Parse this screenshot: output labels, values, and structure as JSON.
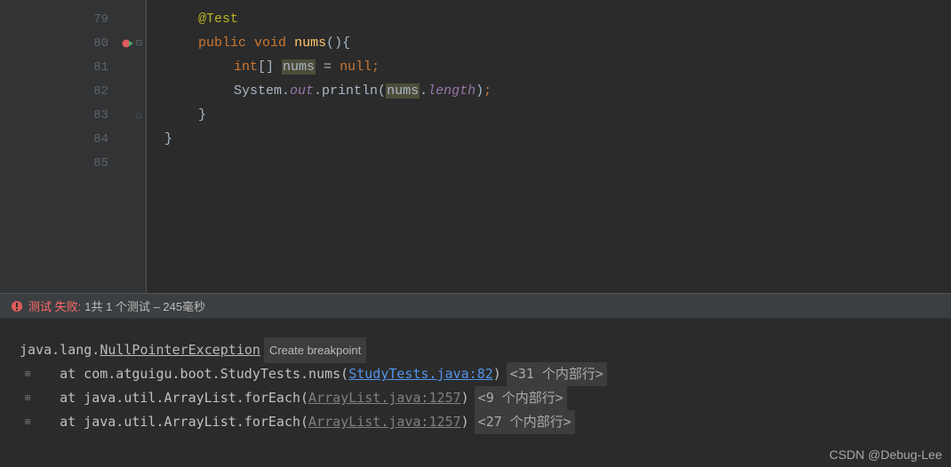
{
  "gutter": {
    "lines": [
      "79",
      "80",
      "81",
      "82",
      "83",
      "84",
      "85"
    ]
  },
  "code": {
    "l79_annotation": "@Test",
    "l80_public": "public",
    "l80_void": "void",
    "l80_method": "nums",
    "l80_paren": "(){",
    "l81_type": "int",
    "l81_brackets": "[] ",
    "l81_var": "nums",
    "l81_eq": " = ",
    "l81_null": "null",
    "l81_semi": ";",
    "l82_sys": "System.",
    "l82_out": "out",
    "l82_dot": ".",
    "l82_println": "println(",
    "l82_var": "nums",
    "l82_dot2": ".",
    "l82_length": "length",
    "l82_close": ")",
    "l82_semi": ";",
    "l83_close": "}",
    "l84_close": "}"
  },
  "console": {
    "header_fail": "测试 失败:",
    "header_rest": " 1共 1 个测试 – 245毫秒",
    "exception_prefix": "java.lang.",
    "exception_name": "NullPointerException",
    "create_bp": "Create breakpoint",
    "stack1_prefix": "   at com.atguigu.boot.StudyTests.nums(",
    "stack1_link": "StudyTests.java:82",
    "stack1_close": ")",
    "stack1_info": "<31 个内部行>",
    "stack2_prefix": "   at java.util.ArrayList.forEach(",
    "stack2_link": "ArrayList.java:1257",
    "stack2_close": ")",
    "stack2_info": "<9 个内部行>",
    "stack3_prefix": "   at java.util.ArrayList.forEach(",
    "stack3_link": "ArrayList.java:1257",
    "stack3_close": ")",
    "stack3_info": "<27 个内部行>"
  },
  "watermark": "CSDN @Debug-Lee"
}
